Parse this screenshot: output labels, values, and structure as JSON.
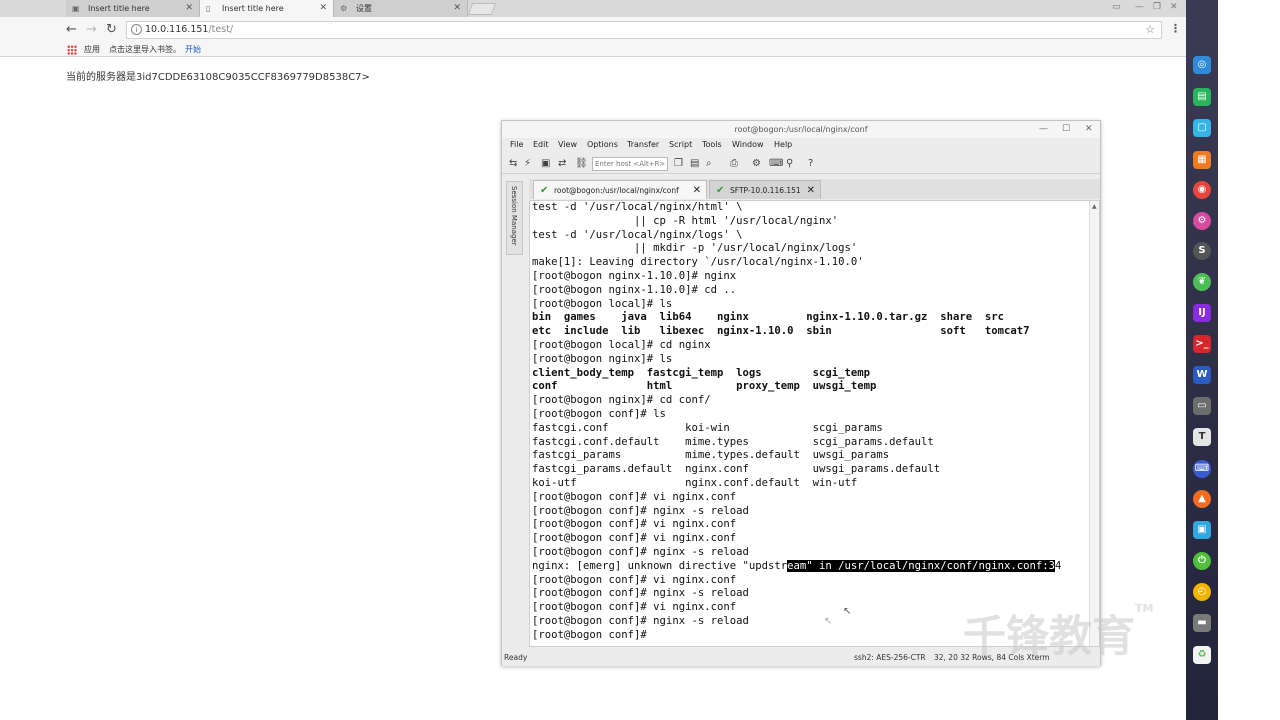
{
  "browser": {
    "tabs": [
      {
        "label": "Insert title here",
        "active": false
      },
      {
        "label": "Insert title here",
        "active": true
      },
      {
        "label": "设置",
        "active": false
      }
    ],
    "url_host": "10.0.116.151",
    "url_path": "/test/",
    "bookmarks": {
      "apps": "应用",
      "import_prompt": "点击这里导入书签。",
      "import_link": "开始"
    },
    "page_text": "当前的服务器是3id7CDDE63108C9035CCF8369779D8538C7>"
  },
  "crt": {
    "title": "root@bogon:/usr/local/nginx/conf",
    "menu": [
      "File",
      "Edit",
      "View",
      "Options",
      "Transfer",
      "Script",
      "Tools",
      "Window",
      "Help"
    ],
    "host_placeholder": "Enter host <Alt+R>",
    "session_manager": "Session Manager",
    "session_tabs": [
      {
        "label": "root@bogon:/usr/local/nginx/conf",
        "active": true
      },
      {
        "label": "SFTP-10.0.116.151",
        "active": false
      }
    ],
    "terminal_lines": [
      "test -d '/usr/local/nginx/html' \\",
      "                || cp -R html '/usr/local/nginx'",
      "test -d '/usr/local/nginx/logs' \\",
      "                || mkdir -p '/usr/local/nginx/logs'",
      "make[1]: Leaving directory `/usr/local/nginx-1.10.0'",
      "[root@bogon nginx-1.10.0]# nginx",
      "[root@bogon nginx-1.10.0]# cd ..",
      "[root@bogon local]# ls",
      "bin  games    java  lib64    nginx         nginx-1.10.0.tar.gz  share  src",
      "etc  include  lib   libexec  nginx-1.10.0  sbin                 soft   tomcat7",
      "[root@bogon local]# cd nginx",
      "[root@bogon nginx]# ls",
      "client_body_temp  fastcgi_temp  logs        scgi_temp",
      "conf              html          proxy_temp  uwsgi_temp",
      "[root@bogon nginx]# cd conf/",
      "[root@bogon conf]# ls",
      "fastcgi.conf            koi-win             scgi_params",
      "fastcgi.conf.default    mime.types          scgi_params.default",
      "fastcgi_params          mime.types.default  uwsgi_params",
      "fastcgi_params.default  nginx.conf          uwsgi_params.default",
      "koi-utf                 nginx.conf.default  win-utf",
      "[root@bogon conf]# vi nginx.conf",
      "[root@bogon conf]# nginx -s reload",
      "[root@bogon conf]# vi nginx.conf",
      "[root@bogon conf]# vi nginx.conf",
      "[root@bogon conf]# nginx -s reload",
      "nginx: [emerg] unknown directive \"updstr",
      "[root@bogon conf]# vi nginx.conf",
      "[root@bogon conf]# nginx -s reload",
      "[root@bogon conf]# vi nginx.conf",
      "[root@bogon conf]# nginx -s reload",
      "[root@bogon conf]# "
    ],
    "error_highlight": "eam\" in /usr/local/nginx/conf/nginx.conf:3",
    "error_tail": "4",
    "status": {
      "ready": "Ready",
      "conn": "ssh2: AES-256-CTR",
      "pos": "32, 20  32 Rows, 84 Cols  Xterm"
    }
  },
  "watermark": "千锋教育",
  "watermark_tm": "TM",
  "colors": {
    "accent": "#2ea02e",
    "terminal_bg": "#ffffff",
    "dock": "#2c2d45"
  }
}
